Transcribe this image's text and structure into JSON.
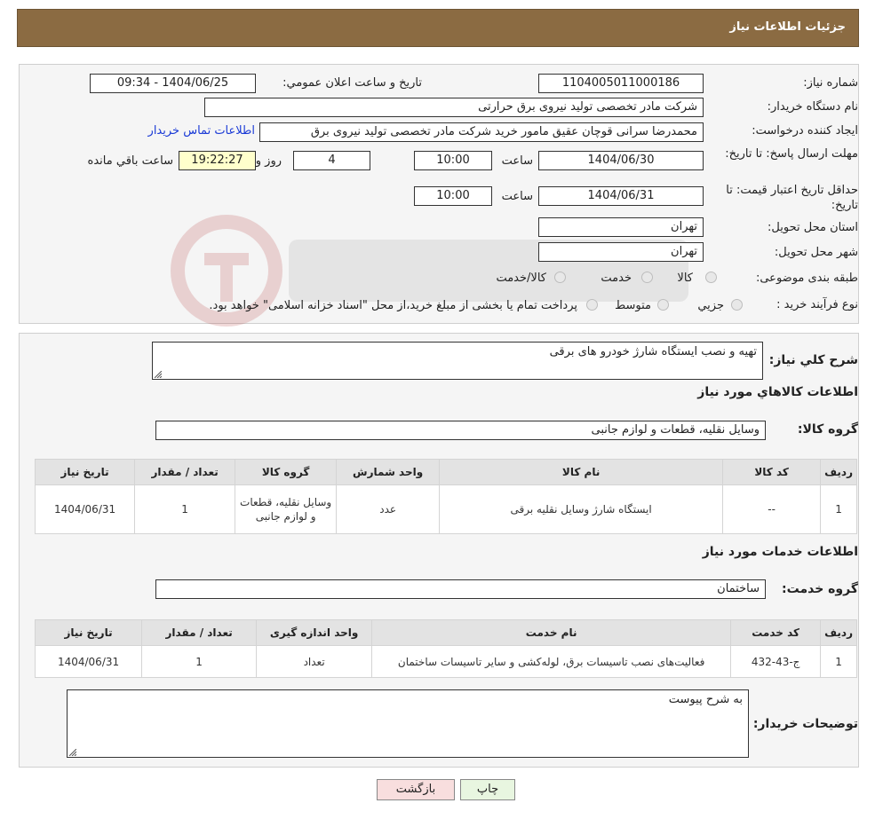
{
  "header": {
    "title": "جزئیات اطلاعات نیاز"
  },
  "form": {
    "need_number_label": "شماره نیاز:",
    "need_number": "1104005011000186",
    "announce_label": "تاریخ و ساعت اعلان عمومي:",
    "announce_value": "1404/06/25 - 09:34",
    "buyer_org_label": "نام دستگاه خریدار:",
    "buyer_org": "شرکت مادر تخصصی تولید نیروی برق حرارتی",
    "creator_label": "ايجاد کننده درخواست:",
    "creator": "محمدرضا سرانی قوچان عقیق مامور خرید شرکت مادر تخصصی تولید نیروی برق",
    "contact_link": "اطلاعات تماس خریدار",
    "deadline_label": "مهلت ارسال پاسخ: تا تاريخ:",
    "deadline_date": "1404/06/30",
    "time_label": "ساعت",
    "deadline_time": "10:00",
    "days_value": "4",
    "days_label": "روز و",
    "remaining_time": "19:22:27",
    "remaining_label": "ساعت باقي مانده",
    "validity_label": "حداقل تاريخ اعتبار قيمت: تا تاريخ:",
    "validity_date": "1404/06/31",
    "validity_time": "10:00",
    "province_label": "استان محل تحویل:",
    "province": "تهران",
    "city_label": "شهر محل تحویل:",
    "city": "تهران",
    "category_label": "طبقه بندی موضوعی:",
    "category_options": [
      "کالا",
      "خدمت",
      "کالا/خدمت"
    ],
    "process_label": "نوع فرآیند خرید :",
    "process_options": [
      "جزيي",
      "متوسط"
    ],
    "process_note": "پرداخت تمام یا بخشی از مبلغ خرید،از محل \"اسناد خزانه اسلامی\" خواهد بود."
  },
  "details": {
    "desc_label": "شرح کلي نياز:",
    "desc_value": "تهیه و نصب ایستگاه شارژ خودرو های برقی",
    "goods_title": "اطلاعات کالاهاي مورد نياز",
    "goods_group_label": "گروه کالا:",
    "goods_group": "وسایل نقلیه، قطعات و لوازم جانبی",
    "goods_headers": [
      "رديف",
      "کد کالا",
      "نام کالا",
      "واحد شمارش",
      "گروه کالا",
      "تعداد / مقدار",
      "تاريخ نياز"
    ],
    "goods_row": [
      "1",
      "--",
      "ایستگاه شارژ وسایل نقلیه برقی",
      "عدد",
      "وسایل نقلیه، قطعات و لوازم جانبی",
      "1",
      "1404/06/31"
    ],
    "services_title": "اطلاعات خدمات مورد نياز",
    "service_group_label": "گروه خدمت:",
    "service_group": "ساختمان",
    "service_headers": [
      "رديف",
      "کد خدمت",
      "نام خدمت",
      "واحد اندازه گيری",
      "تعداد / مقدار",
      "تاريخ نياز"
    ],
    "service_row": [
      "1",
      "ج-43-432",
      "فعالیت‌های نصب تاسیسات برق، لوله‌کشی و سایر تاسیسات ساختمان",
      "تعداد",
      "1",
      "1404/06/31"
    ],
    "buyer_notes_label": "توضيحات خريدار:",
    "buyer_notes": "به شرح پیوست"
  },
  "buttons": {
    "print": "چاپ",
    "back": "بازگشت"
  },
  "colors": {
    "header_bg": "#8b6b42",
    "panel_bg": "#f5f5f5",
    "time_bg": "#ffffcc",
    "link": "#1a3ad6",
    "back_bg": "#f8dede",
    "print_bg": "#e8f6e0"
  }
}
